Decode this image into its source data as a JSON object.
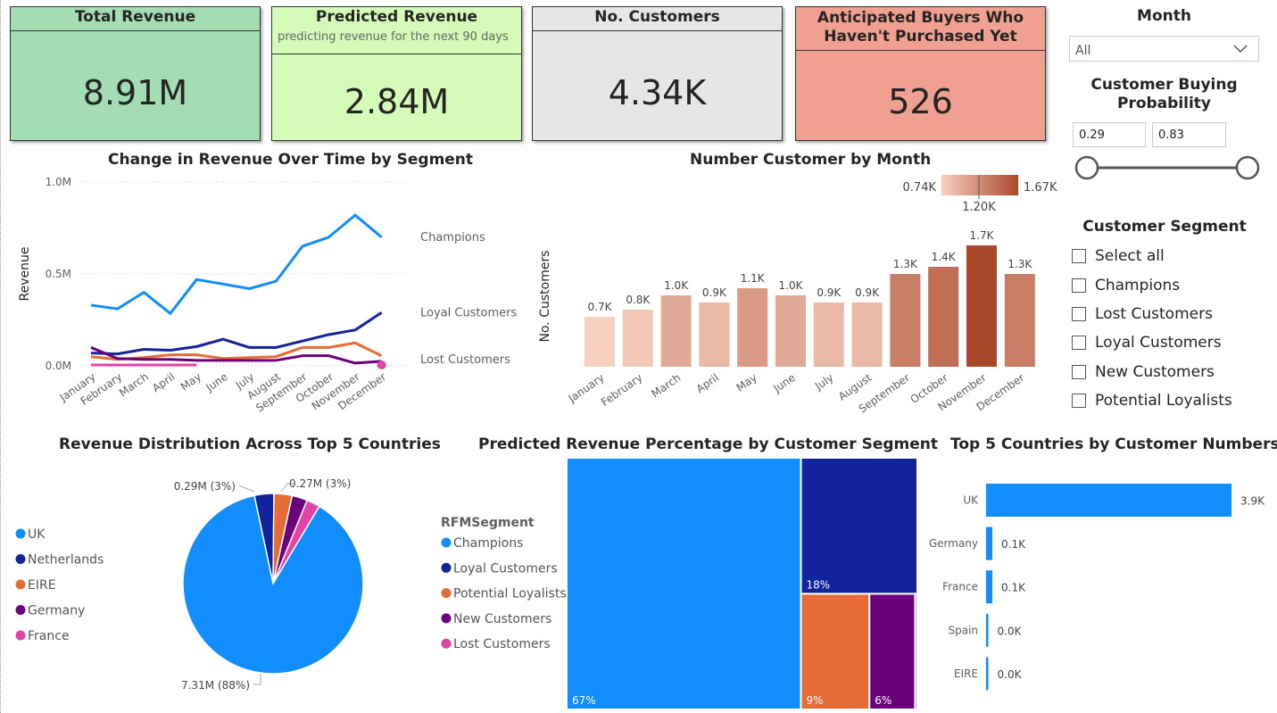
{
  "kpis": {
    "total_revenue": {
      "title": "Total Revenue",
      "value": "8.91M",
      "color": "#a4ddb4"
    },
    "predicted_revenue": {
      "title": "Predicted Revenue",
      "subtitle": "predicting revenue for the next 90 days",
      "value": "2.84M",
      "color": "#d4fbb8"
    },
    "customers": {
      "title": "No. Customers",
      "value": "4.34K",
      "color": "#e6e6e6"
    },
    "anticipated": {
      "title": "Anticipated Buyers Who Haven't Purchased Yet",
      "value": "526",
      "color": "#f0a090"
    }
  },
  "slicers": {
    "month": {
      "title": "Month",
      "selected": "All"
    },
    "probability": {
      "title": "Customer Buying Probability",
      "min": "0.29",
      "max": "0.83"
    },
    "segment": {
      "title": "Customer Segment",
      "items": [
        "Select all",
        "Champions",
        "Lost Customers",
        "Loyal Customers",
        "New Customers",
        "Potential Loyalists"
      ]
    }
  },
  "icons": [
    "chevron-down-icon",
    "checkbox-icon",
    "slider-handle-icon"
  ],
  "chart_data": [
    {
      "id": "revenue_line",
      "type": "line",
      "title": "Change in Revenue Over Time by Segment",
      "ylabel": "Revenue",
      "xlabel": "",
      "ylim": [
        0,
        1000000
      ],
      "yticks": [
        "0.0M",
        "0.5M",
        "1.0M"
      ],
      "grid": true,
      "categories": [
        "January",
        "February",
        "March",
        "April",
        "May",
        "June",
        "July",
        "August",
        "September",
        "October",
        "November",
        "December"
      ],
      "series": [
        {
          "name": "Champions",
          "color": "#118DFF",
          "values": [
            330000,
            310000,
            400000,
            285000,
            470000,
            445000,
            420000,
            460000,
            650000,
            700000,
            820000,
            700000
          ]
        },
        {
          "name": "Loyal Customers",
          "color": "#12239E",
          "values": [
            70000,
            65000,
            90000,
            85000,
            105000,
            145000,
            100000,
            100000,
            135000,
            170000,
            195000,
            290000
          ]
        },
        {
          "name": "",
          "color": "#E66C37",
          "values": [
            50000,
            35000,
            45000,
            60000,
            60000,
            40000,
            45000,
            50000,
            100000,
            100000,
            125000,
            55000
          ]
        },
        {
          "name": "",
          "color": "#6B007B",
          "values": [
            100000,
            40000,
            35000,
            35000,
            30000,
            30000,
            30000,
            30000,
            55000,
            55000,
            15000,
            25000
          ]
        },
        {
          "name": "Lost Customers",
          "color": "#E044A7",
          "values": [
            5000,
            5000,
            5000,
            5000,
            5000,
            null,
            null,
            null,
            null,
            null,
            null,
            5000
          ]
        }
      ]
    },
    {
      "id": "customers_month",
      "type": "bar",
      "title": "Number Customer by Month",
      "ylabel": "No. Customers",
      "xlabel": "",
      "ylim": [
        0,
        1.7
      ],
      "categories": [
        "January",
        "February",
        "March",
        "April",
        "May",
        "June",
        "July",
        "August",
        "September",
        "October",
        "November",
        "December"
      ],
      "values": [
        0.7,
        0.8,
        1.0,
        0.9,
        1.1,
        1.0,
        0.9,
        0.9,
        1.3,
        1.4,
        1.7,
        1.3
      ],
      "labels": [
        "0.7K",
        "0.8K",
        "1.0K",
        "0.9K",
        "1.1K",
        "1.0K",
        "0.9K",
        "0.9K",
        "1.3K",
        "1.4K",
        "1.7K",
        "1.3K"
      ],
      "color_scale": {
        "min_label": "0.74K",
        "mid_label": "1.20K",
        "max_label": "1.67K",
        "min_color": "#F7D0C0",
        "max_color": "#A9482A"
      }
    },
    {
      "id": "revenue_countries_pie",
      "type": "pie",
      "title": "Revenue Distribution Across Top 5 Countries",
      "legend_position": "left",
      "slices": [
        {
          "name": "UK",
          "value": 7.31,
          "color": "#118DFF"
        },
        {
          "name": "Netherlands",
          "value": 0.29,
          "color": "#12239E"
        },
        {
          "name": "EIRE",
          "value": 0.27,
          "color": "#E66C37"
        },
        {
          "name": "Germany",
          "value": 0.23,
          "color": "#6B007B"
        },
        {
          "name": "France",
          "value": 0.2,
          "color": "#E044A7"
        }
      ],
      "data_labels": [
        "0.29M (3%)",
        "0.27M (3%)",
        "7.31M (88%)"
      ]
    },
    {
      "id": "segment_treemap",
      "type": "treemap",
      "title": "Predicted Revenue Percentage by Customer Segment",
      "legend_title": "RFMSegment",
      "legend_position": "left",
      "segments": [
        {
          "name": "Champions",
          "value": 67,
          "label": "67%",
          "color": "#118DFF"
        },
        {
          "name": "Loyal Customers",
          "value": 18,
          "label": "18%",
          "color": "#12239E"
        },
        {
          "name": "Potential Loyalists",
          "value": 9,
          "label": "9%",
          "color": "#E66C37"
        },
        {
          "name": "New Customers",
          "value": 6,
          "label": "6%",
          "color": "#6B007B"
        },
        {
          "name": "Lost Customers",
          "value": 0.3,
          "label": "",
          "color": "#E044A7"
        }
      ]
    },
    {
      "id": "customers_countries",
      "type": "bar",
      "orientation": "horizontal",
      "title": "Top 5 Countries by Customer Numbers",
      "categories": [
        "UK",
        "Germany",
        "France",
        "Spain",
        "EIRE"
      ],
      "values": [
        3.9,
        0.1,
        0.1,
        0.03,
        0.02
      ],
      "labels": [
        "3.9K",
        "0.1K",
        "0.1K",
        "0.0K",
        "0.0K"
      ],
      "color": "#118DFF"
    }
  ]
}
